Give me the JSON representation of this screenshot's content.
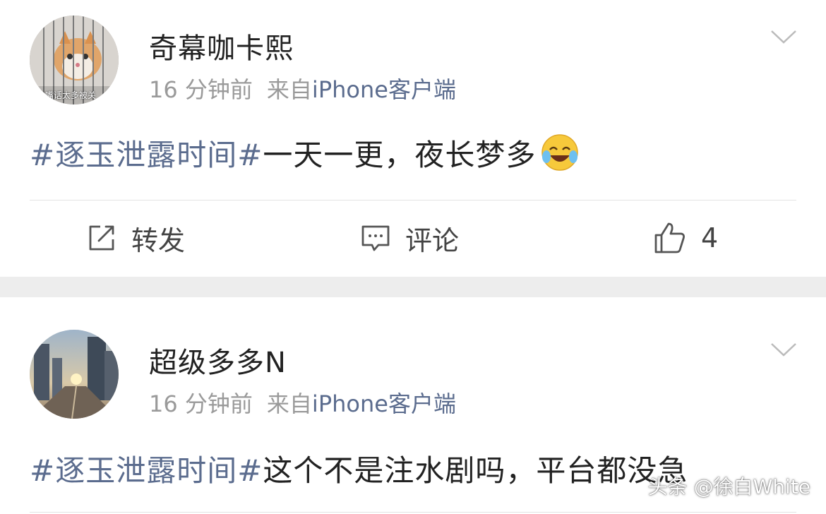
{
  "posts": [
    {
      "username": "奇幕咖卡熙",
      "time": "16 分钟前",
      "source_prefix": "来自",
      "source": "iPhone客户端",
      "hashtag": "#逐玉泄露时间#",
      "text": "一天一更，夜长梦多",
      "emoji": "laughing-crying-emoji",
      "avatar_caption": "由嘴话太多被关",
      "actions": {
        "repost": "转发",
        "comment": "评论",
        "like": "4"
      }
    },
    {
      "username": "超级多多N",
      "time": "16 分钟前",
      "source_prefix": "来自",
      "source": "iPhone客户端",
      "hashtag": "#逐玉泄露时间#",
      "text": "这个不是注水剧吗，平台都没急"
    }
  ],
  "watermark": "头条 @徐白White",
  "colors": {
    "link": "#5b6c8e",
    "meta": "#9a9a9a",
    "separator": "#ededed"
  },
  "icons": [
    "chevron-down-icon",
    "repost-icon",
    "comment-icon",
    "like-icon"
  ]
}
